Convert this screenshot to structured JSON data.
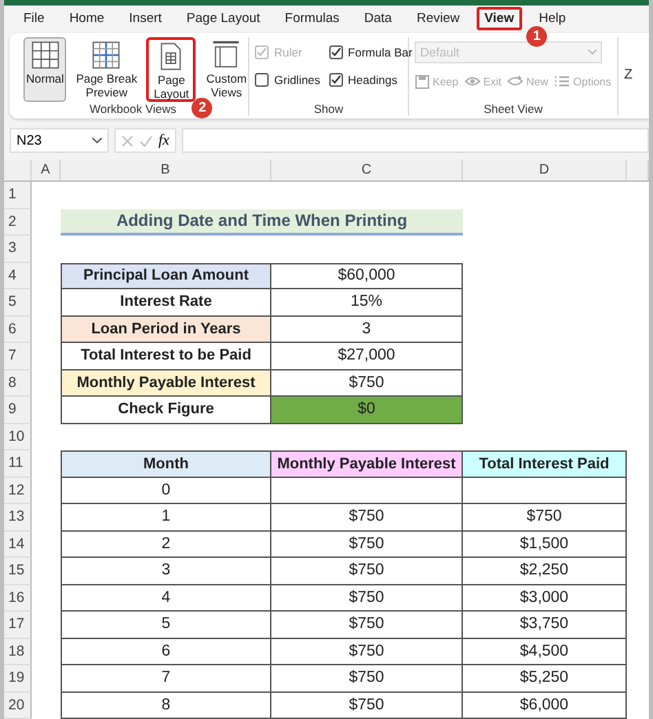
{
  "menu": [
    {
      "label": "File",
      "selected": false
    },
    {
      "label": "Home",
      "selected": false
    },
    {
      "label": "Insert",
      "selected": false
    },
    {
      "label": "Page Layout",
      "selected": false
    },
    {
      "label": "Formulas",
      "selected": false
    },
    {
      "label": "Data",
      "selected": false
    },
    {
      "label": "Review",
      "selected": false
    },
    {
      "label": "View",
      "selected": true,
      "badge": "1"
    },
    {
      "label": "Help",
      "selected": false
    }
  ],
  "ribbon": {
    "workbook_views": {
      "title": "Workbook Views",
      "buttons": [
        {
          "kind": "normal",
          "label": "Normal",
          "selected": true
        },
        {
          "kind": "pagebreak",
          "label": "Page Break Preview",
          "selected": false
        },
        {
          "kind": "pagelayout",
          "label": "Page Layout",
          "selected": false,
          "badge": "2"
        },
        {
          "kind": "custom",
          "label": "Custom Views",
          "selected": false
        }
      ]
    },
    "show": {
      "title": "Show",
      "options": [
        {
          "label": "Ruler",
          "checked": true,
          "disabled": true
        },
        {
          "label": "Formula Bar",
          "checked": true,
          "disabled": false
        },
        {
          "label": "Gridlines",
          "checked": false,
          "disabled": false
        },
        {
          "label": "Headings",
          "checked": true,
          "disabled": false
        }
      ]
    },
    "sheet_view": {
      "title": "Sheet View",
      "dropdown": "Default",
      "buttons": [
        {
          "kind": "keep",
          "label": "Keep"
        },
        {
          "kind": "exit",
          "label": "Exit"
        },
        {
          "kind": "new",
          "label": "New"
        },
        {
          "kind": "options",
          "label": "Options"
        }
      ]
    },
    "cut_label": "Z"
  },
  "formula_bar": {
    "name_box": "N23",
    "fx": "fx"
  },
  "sheet": {
    "columns": [
      "A",
      "B",
      "C",
      "D"
    ],
    "rows": [
      {
        "number": "1",
        "kind": "blank"
      },
      {
        "number": "2",
        "kind": "title",
        "text": "Adding Date and Time When Printing"
      },
      {
        "number": "3",
        "kind": "blank"
      },
      {
        "number": "4",
        "kind": "pair",
        "label": {
          "text": "Principal Loan Amount",
          "color": "#dae3f3"
        },
        "value": {
          "text": "$60,000",
          "color": "#ffffff"
        }
      },
      {
        "number": "5",
        "kind": "pair",
        "label": {
          "text": "Interest Rate",
          "color": "#ffffff"
        },
        "value": {
          "text": "15%",
          "color": "#ffffff"
        }
      },
      {
        "number": "6",
        "kind": "pair",
        "label": {
          "text": "Loan Period in Years",
          "color": "#fbe5d6"
        },
        "value": {
          "text": "3",
          "color": "#ffffff"
        }
      },
      {
        "number": "7",
        "kind": "pair",
        "label": {
          "text": "Total Interest to be Paid",
          "color": "#ffffff"
        },
        "value": {
          "text": "$27,000",
          "color": "#ffffff"
        }
      },
      {
        "number": "8",
        "kind": "pair",
        "label": {
          "text": "Monthly Payable Interest",
          "color": "#fff2cc"
        },
        "value": {
          "text": "$750",
          "color": "#ffffff"
        }
      },
      {
        "number": "9",
        "kind": "pair",
        "label": {
          "text": "Check Figure",
          "color": "#ffffff"
        },
        "value": {
          "text": "$0",
          "color": "#70ad47"
        }
      },
      {
        "number": "10",
        "kind": "blank"
      },
      {
        "number": "11",
        "kind": "header",
        "cells": [
          {
            "text": "Month",
            "color": "#ddebf7"
          },
          {
            "text": "Monthly Payable Interest",
            "color": "#ffccff"
          },
          {
            "text": "Total Interest Paid",
            "color": "#ccffff"
          }
        ]
      },
      {
        "number": "12",
        "kind": "data",
        "cells": [
          "0"
        ]
      },
      {
        "number": "13",
        "kind": "data",
        "cells": [
          "1",
          "$750",
          "$750"
        ]
      },
      {
        "number": "14",
        "kind": "data",
        "cells": [
          "2",
          "$750",
          "$1,500"
        ]
      },
      {
        "number": "15",
        "kind": "data",
        "cells": [
          "3",
          "$750",
          "$2,250"
        ]
      },
      {
        "number": "16",
        "kind": "data",
        "cells": [
          "4",
          "$750",
          "$3,000"
        ]
      },
      {
        "number": "17",
        "kind": "data",
        "cells": [
          "5",
          "$750",
          "$3,750"
        ]
      },
      {
        "number": "18",
        "kind": "data",
        "cells": [
          "6",
          "$750",
          "$4,500"
        ]
      },
      {
        "number": "19",
        "kind": "data",
        "cells": [
          "7",
          "$750",
          "$5,250"
        ]
      },
      {
        "number": "20",
        "kind": "data",
        "cells": [
          "8",
          "$750",
          "$6,000"
        ]
      }
    ]
  }
}
